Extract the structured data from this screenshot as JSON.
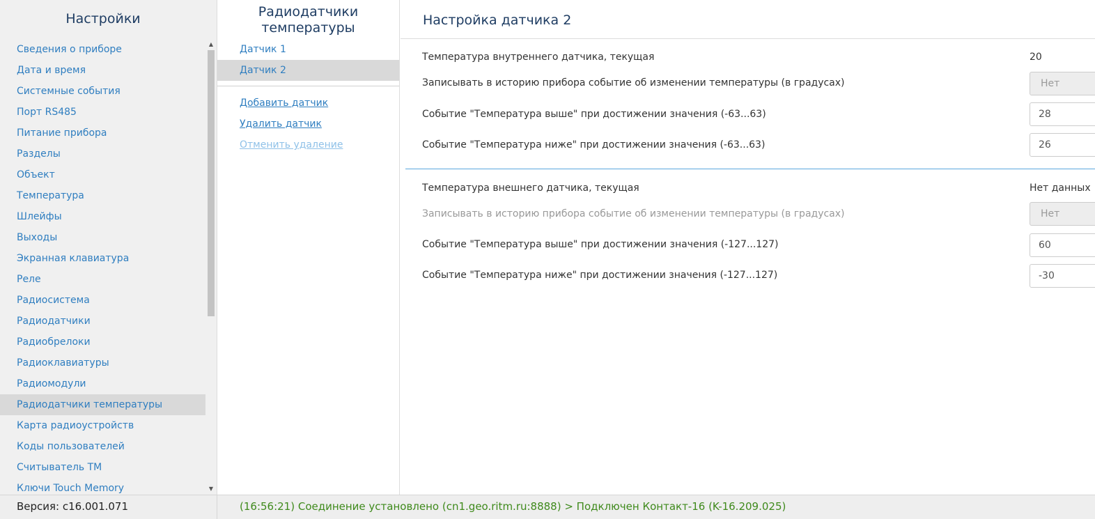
{
  "sidebar": {
    "title": "Настройки",
    "items": [
      {
        "label": "Сведения о приборе"
      },
      {
        "label": "Дата и время"
      },
      {
        "label": "Системные события"
      },
      {
        "label": "Порт RS485"
      },
      {
        "label": "Питание прибора"
      },
      {
        "label": "Разделы"
      },
      {
        "label": "Объект"
      },
      {
        "label": "Температура"
      },
      {
        "label": "Шлейфы"
      },
      {
        "label": "Выходы"
      },
      {
        "label": "Экранная клавиатура"
      },
      {
        "label": "Реле"
      },
      {
        "label": "Радиосистема"
      },
      {
        "label": "Радиодатчики"
      },
      {
        "label": "Радиобрелоки"
      },
      {
        "label": "Радиоклавиатуры"
      },
      {
        "label": "Радиомодули"
      },
      {
        "label": "Радиодатчики температуры"
      },
      {
        "label": "Карта радиоустройств"
      },
      {
        "label": "Коды пользователей"
      },
      {
        "label": "Считыватель ТМ"
      },
      {
        "label": "Ключи Touch Memory"
      }
    ],
    "active_index": 17
  },
  "sensors": {
    "title": "Радиодатчики температуры",
    "items": [
      {
        "label": "Датчик 1"
      },
      {
        "label": "Датчик 2"
      }
    ],
    "active_index": 1,
    "actions": {
      "add": "Добавить датчик",
      "delete": "Удалить датчик",
      "undo": "Отменить удаление"
    }
  },
  "main": {
    "title": "Настройка датчика 2",
    "internal": {
      "current_label": "Температура внутреннего датчика, текущая",
      "current_value": "20",
      "log_label": "Записывать в историю прибора событие об изменении температуры (в градусах)",
      "log_value": "Нет",
      "high_label": "Событие \"Температура выше\" при достижении значения (-63...63)",
      "high_value": "28",
      "low_label": "Событие \"Температура ниже\" при достижении значения (-63...63)",
      "low_value": "26"
    },
    "external": {
      "current_label": "Температура внешнего датчика, текущая",
      "current_value": "Нет данных",
      "log_label": "Записывать в историю прибора событие об изменении температуры (в градусах)",
      "log_value": "Нет",
      "high_label": "Событие \"Температура выше\" при достижении значения (-127...127)",
      "high_value": "60",
      "low_label": "Событие \"Температура ниже\" при достижении значения (-127...127)",
      "low_value": "-30"
    }
  },
  "statusbar": {
    "version": "Версия: c16.001.071",
    "status": "(16:56:21) Соединение установлено (cn1.geo.ritm.ru:8888) > Подключен Контакт-16 (K-16.209.025)"
  },
  "colors": {
    "link": "#2f7ec0",
    "heading": "#1f3d63",
    "status_ok": "#3f8a1c",
    "divider_accent": "#5aa6dd"
  }
}
